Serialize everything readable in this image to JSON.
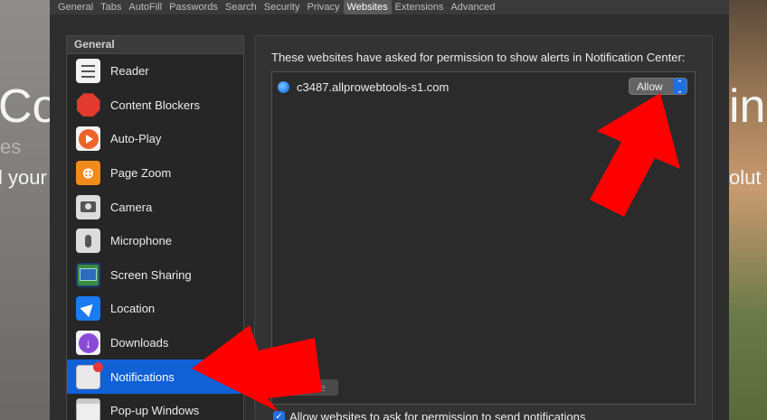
{
  "background": {
    "headline_left": "Co",
    "headline_right": "in",
    "sub_left": "l your",
    "sub_right": "olut",
    "faint_left": "es"
  },
  "tabs": [
    {
      "label": "General"
    },
    {
      "label": "Tabs"
    },
    {
      "label": "AutoFill"
    },
    {
      "label": "Passwords"
    },
    {
      "label": "Search"
    },
    {
      "label": "Security"
    },
    {
      "label": "Privacy"
    },
    {
      "label": "Websites",
      "active": true
    },
    {
      "label": "Extensions"
    },
    {
      "label": "Advanced"
    }
  ],
  "sidebar": {
    "header": "General",
    "items": [
      {
        "label": "Reader",
        "icon": "reader-icon"
      },
      {
        "label": "Content Blockers",
        "icon": "stop-sign-icon"
      },
      {
        "label": "Auto-Play",
        "icon": "play-icon"
      },
      {
        "label": "Page Zoom",
        "icon": "zoom-icon"
      },
      {
        "label": "Camera",
        "icon": "camera-icon"
      },
      {
        "label": "Microphone",
        "icon": "microphone-icon"
      },
      {
        "label": "Screen Sharing",
        "icon": "screen-sharing-icon"
      },
      {
        "label": "Location",
        "icon": "location-arrow-icon"
      },
      {
        "label": "Downloads",
        "icon": "download-icon"
      },
      {
        "label": "Notifications",
        "icon": "notification-icon",
        "selected": true
      },
      {
        "label": "Pop-up Windows",
        "icon": "popup-window-icon"
      }
    ]
  },
  "panel": {
    "title": "These websites have asked for permission to show alerts in Notification Center:",
    "sites": [
      {
        "name": "c3487.allprowebtools-s1.com",
        "permission": "Allow"
      }
    ],
    "remove_label": "Remove",
    "allow_checkbox_label": "Allow websites to ask for permission to send notifications",
    "allow_checked": true
  },
  "colors": {
    "selection": "#1060d6",
    "arrow": "#ff0000"
  }
}
